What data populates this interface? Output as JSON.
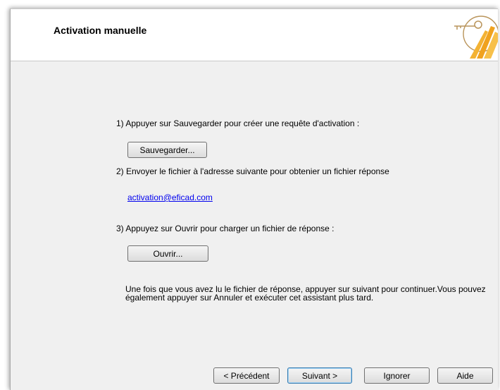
{
  "header": {
    "title": "Activation manuelle"
  },
  "steps": {
    "step1": "1) Appuyer sur Sauvegarder pour créer une requête d'activation :",
    "save_button": "Sauvegarder...",
    "step2": "2) Envoyer le fichier à l'adresse suivante pour obtenier un fichier réponse",
    "email": "activation@eficad.com",
    "step3": "3) Appuyez sur Ouvrir pour charger un fichier de réponse :",
    "open_button": "Ouvrir..."
  },
  "note": "Une fois que vous avez lu le fichier de réponse, appuyer sur suivant pour continuer.Vous pouvez également appuyer sur Annuler et exécuter cet assistant plus tard.",
  "footer": {
    "previous": "< Précédent",
    "next": "Suivant >",
    "ignore": "Ignorer",
    "help": "Aide"
  },
  "icons": {
    "logo": "key-sun-logo-icon"
  },
  "colors": {
    "link": "#0000ee",
    "logo_orange": "#f0a21e",
    "logo_ring": "#b9945a"
  }
}
